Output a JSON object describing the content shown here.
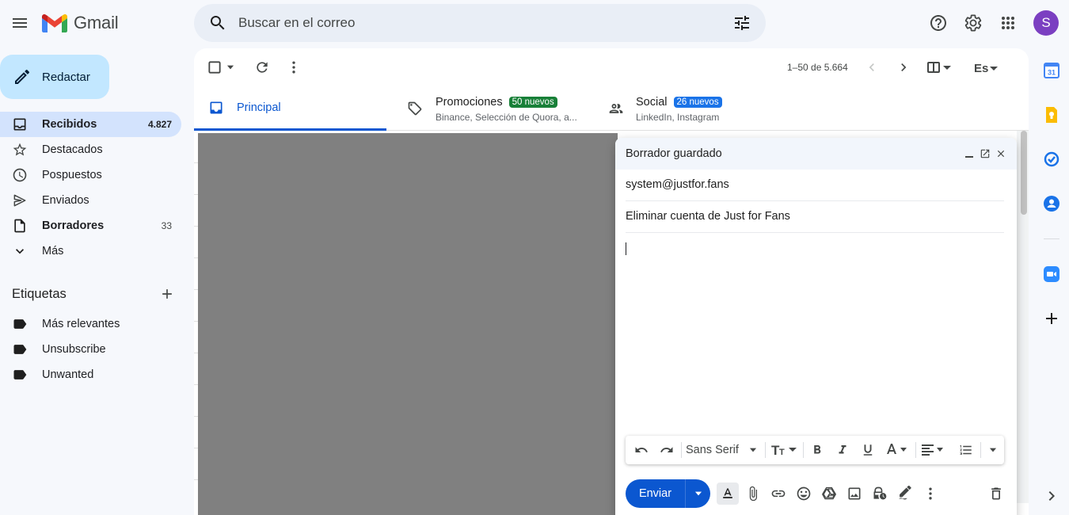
{
  "app": {
    "name": "Gmail"
  },
  "search": {
    "placeholder": "Buscar en el correo"
  },
  "user": {
    "avatar_letter": "S"
  },
  "compose_button": {
    "label": "Redactar"
  },
  "nav": [
    {
      "label": "Recibidos",
      "count": "4.827",
      "icon": "inbox-icon"
    },
    {
      "label": "Destacados",
      "count": "",
      "icon": "star-icon"
    },
    {
      "label": "Pospuestos",
      "count": "",
      "icon": "clock-icon"
    },
    {
      "label": "Enviados",
      "count": "",
      "icon": "send-icon"
    },
    {
      "label": "Borradores",
      "count": "33",
      "icon": "draft-icon"
    },
    {
      "label": "Más",
      "count": "",
      "icon": "chevron-down-icon"
    }
  ],
  "labels": {
    "title": "Etiquetas",
    "items": [
      {
        "label": "Más relevantes"
      },
      {
        "label": "Unsubscribe"
      },
      {
        "label": "Unwanted"
      }
    ]
  },
  "toolbar": {
    "pager": "1–50 de 5.664"
  },
  "tabs": [
    {
      "title": "Principal",
      "badge": "",
      "subtitle": ""
    },
    {
      "title": "Promociones",
      "badge": "50 nuevos",
      "subtitle": "Binance, Selección de Quora, a..."
    },
    {
      "title": "Social",
      "badge": "26 nuevos",
      "subtitle": "LinkedIn, Instagram"
    }
  ],
  "compose": {
    "title": "Borrador guardado",
    "to": "system@justfor.fans",
    "subject": "Eliminar cuenta de Just for Fans",
    "font": "Sans Serif",
    "send_label": "Enviar"
  },
  "colors": {
    "accent": "#0b57d0",
    "compose_button_bg": "#c2e7ff",
    "active_nav_bg": "#d3e3fd",
    "promo_badge": "#188038",
    "social_badge": "#1a73e8",
    "avatar_bg": "#7b3fc1"
  }
}
